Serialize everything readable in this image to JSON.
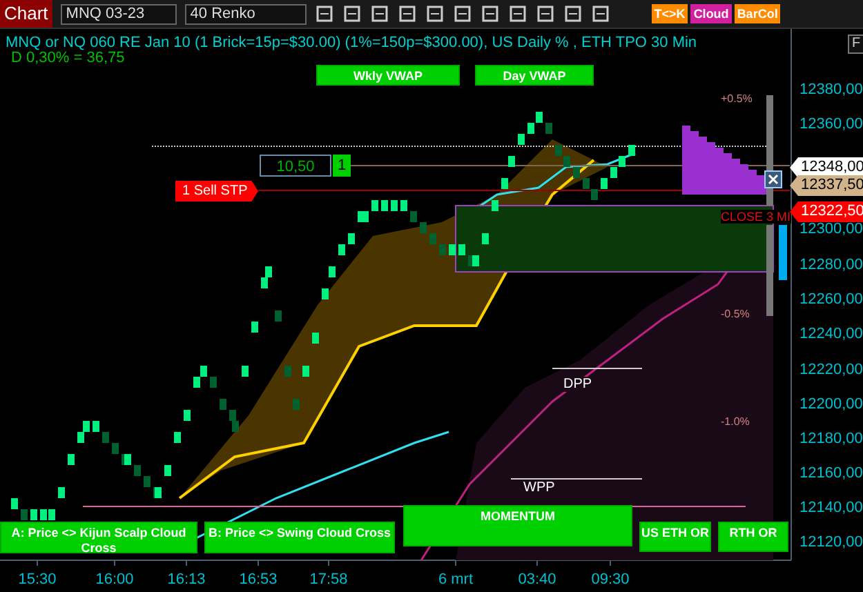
{
  "toolbar": {
    "title": "Chart",
    "instrument": "MNQ 03-23",
    "bar_type": "40 Renko",
    "badges": [
      {
        "label": "T<>K",
        "color": "#ff8c00"
      },
      {
        "label": "Cloud",
        "color": "#d020a0"
      },
      {
        "label": "BarCol",
        "color": "#ff8c00"
      }
    ]
  },
  "chart": {
    "title": "MNQ or NQ 060 RE Jan 10 (1 Brick=15p=$30.00) (1%=150p=$300.00), US Daily % , ETH TPO 30 Min",
    "subtitle": "D 0,30% = 36,75",
    "f_button": "F",
    "top_buttons": [
      "Wkly VWAP",
      "Day VWAP"
    ],
    "percent_labels": [
      "+0.5%",
      "-0.5%",
      "-1.0%"
    ],
    "level_labels": [
      "DPP",
      "WPP"
    ],
    "order": {
      "value": "10,50",
      "quantity": "1",
      "sell_label": "1 Sell STP"
    },
    "close_label": "CLOSE 3 MI",
    "price_tags": [
      {
        "text": "12348,00",
        "color": "#ffffff"
      },
      {
        "text": "12337,50",
        "color": "#d2b48c"
      },
      {
        "text": "12322,50",
        "color": "#ff0000"
      }
    ],
    "price_axis": [
      "12380,00",
      "12360,00",
      "12300,00",
      "12280,00",
      "12260,00",
      "12240,00",
      "12220,00",
      "12200,00",
      "12180,00",
      "12160,00",
      "12140,00",
      "12120,00"
    ],
    "time_axis": [
      "15:30",
      "16:00",
      "16:13",
      "16:53",
      "17:58",
      "6 mrt",
      "03:40",
      "09:30"
    ],
    "bottom_buttons": [
      "A: Price <> Kijun Scalp Cloud Cross",
      "B: Price <> Swing Cloud Cross",
      "MOMENTUM",
      "US ETH OR",
      "RTH OR"
    ]
  }
}
